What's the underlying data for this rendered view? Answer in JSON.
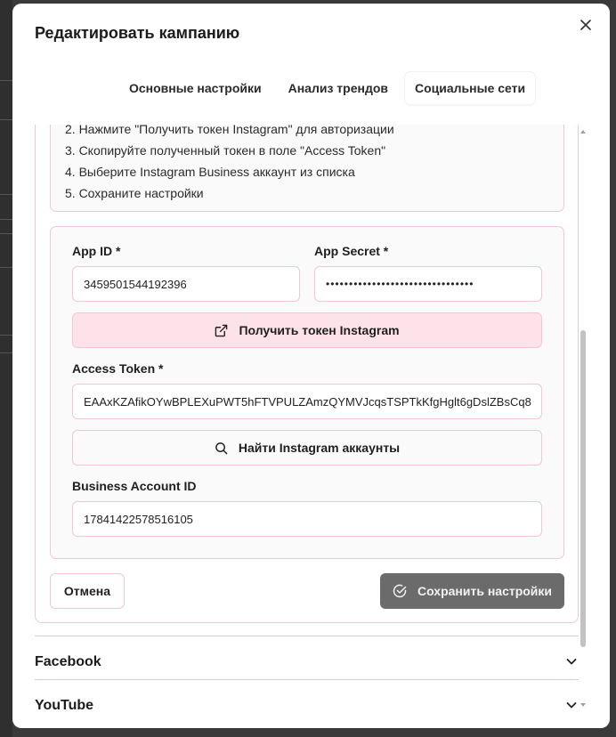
{
  "modal": {
    "title": "Редактировать кампанию",
    "close_label": "×"
  },
  "tabs": [
    {
      "label": "Основные настройки",
      "active": false
    },
    {
      "label": "Анализ трендов",
      "active": false
    },
    {
      "label": "Социальные сети",
      "active": true
    }
  ],
  "instructions": [
    "2. Нажмите \"Получить токен Instagram\" для авторизации",
    "3. Скопируйте полученный токен в поле \"Access Token\"",
    "4. Выберите Instagram Business аккаунт из списка",
    "5. Сохраните настройки"
  ],
  "form": {
    "app_id_label": "App ID *",
    "app_id_value": "3459501544192396",
    "app_secret_label": "App Secret *",
    "app_secret_value": "••••••••••••••••••••••••••••••••",
    "get_token_label": "Получить токен Instagram",
    "access_token_label": "Access Token *",
    "access_token_value": "EAAxKZAfikOYwBPLEXuPWT5hFTVPULZAmzQYMVJcqsTSPTkKfgHglt6gDslZBsCq8",
    "find_accounts_label": "Найти Instagram аккаунты",
    "business_id_label": "Business Account ID",
    "business_id_value": "17841422578516105"
  },
  "actions": {
    "cancel_label": "Отмена",
    "save_label": "Сохранить настройки"
  },
  "sections": [
    {
      "title": "Facebook"
    },
    {
      "title": "YouTube"
    }
  ],
  "colors": {
    "accent_border": "#f4c5d3",
    "token_button_bg": "#fde3e9",
    "save_button_bg": "#6b6b6b"
  }
}
